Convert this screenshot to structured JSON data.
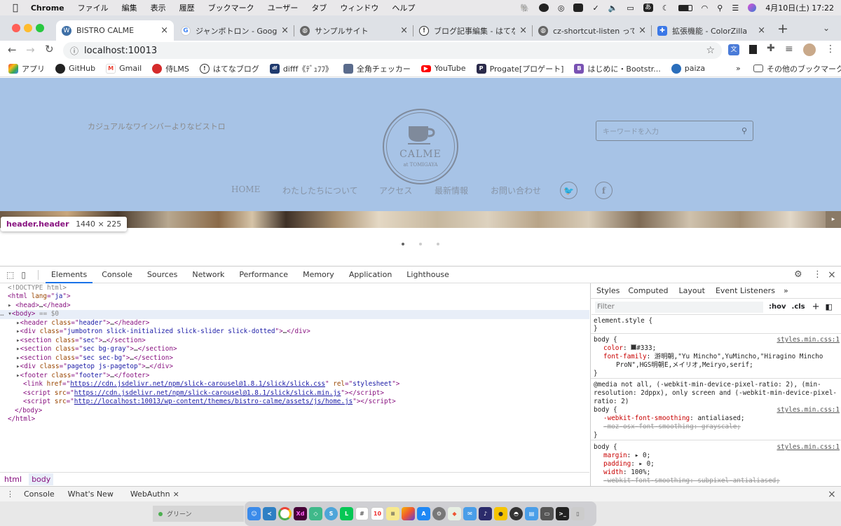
{
  "menubar": {
    "app": "Chrome",
    "items": [
      "ファイル",
      "編集",
      "表示",
      "履歴",
      "ブックマーク",
      "ユーザー",
      "タブ",
      "ウィンドウ",
      "ヘルプ"
    ],
    "datetime": "4月10日(土)  17:22",
    "ime": "あ"
  },
  "tabs": [
    {
      "title": "BISTRO CALME",
      "icon": "wordpress-icon",
      "active": true
    },
    {
      "title": "ジャンボトロン - Google 検索",
      "icon": "google-icon",
      "active": false
    },
    {
      "title": "サンプルサイト",
      "icon": "globe-icon",
      "active": false
    },
    {
      "title": "ブログ記事編集 - はてなブログ",
      "icon": "hatena-icon",
      "active": false
    },
    {
      "title": "cz-shortcut-listen って何",
      "icon": "globe-icon",
      "active": false
    },
    {
      "title": "拡張機能 - ColorZilla",
      "icon": "puzzle-icon",
      "active": false
    }
  ],
  "url": "localhost:10013",
  "bookmarks": [
    {
      "label": "アプリ",
      "color": "#e8453c"
    },
    {
      "label": "GitHub",
      "color": "#222222"
    },
    {
      "label": "Gmail",
      "color": "#ea4335"
    },
    {
      "label": "侍LMS",
      "color": "#d52b2b"
    },
    {
      "label": "はてなブログ",
      "color": "#333333"
    },
    {
      "label": "difff《ﾃﾞｭﾌﾌ》",
      "color": "#1f3a6e"
    },
    {
      "label": "全角チェッカー",
      "color": "#5a6b8c"
    },
    {
      "label": "YouTube",
      "color": "#ff0000"
    },
    {
      "label": "Progate[プロゲート]",
      "color": "#2a2a4a"
    },
    {
      "label": "はじめに・Bootstr...",
      "color": "#7952b3"
    },
    {
      "label": "paiza",
      "color": "#2a6ebb"
    }
  ],
  "bookmarks_other": "その他のブックマーク",
  "site": {
    "tagline": "カジュアルなワインバーよりなビストロ",
    "logo_name": "CALME",
    "logo_sub": "at TOMIGAYA",
    "search_placeholder": "キーワードを入力",
    "nav": [
      "HOME",
      "わたしたちについて",
      "アクセス",
      "最新情報",
      "お問い合わせ"
    ],
    "social": [
      "twitter-icon",
      "facebook-icon"
    ],
    "accent": "#a7c3e6"
  },
  "inspect_tooltip": {
    "selector": "header.header",
    "size": "1440 × 225"
  },
  "devtools": {
    "tabs": [
      "Elements",
      "Console",
      "Sources",
      "Network",
      "Performance",
      "Memory",
      "Application",
      "Lighthouse"
    ],
    "selected_tab": "Elements",
    "style_tabs": [
      "Styles",
      "Computed",
      "Layout",
      "Event Listeners"
    ],
    "filter_placeholder": "Filter",
    "hov": ":hov",
    "cls": ".cls",
    "dom": {
      "doctype": "<!DOCTYPE html>",
      "html_lang": "ja",
      "body_marker": "== $0",
      "link_href": "https://cdn.jsdelivr.net/npm/slick-carousel@1.8.1/slick/slick.css",
      "script1": "https://cdn.jsdelivr.net/npm/slick-carousel@1.8.1/slick/slick.min.js",
      "script2": "http://localhost:10013/wp-content/themes/bistro-calme/assets/js/home.js"
    },
    "styles": {
      "element_style": "element.style {",
      "source": "styles.min.css:1",
      "color_val": "#333;",
      "font_family": "游明朝,\"Yu Mincho\",YuMincho,\"Hiragino Mincho",
      "font_family2": "ProN\",HGS明朝E,メイリオ,Meiryo,serif;",
      "media1": "@media not all, (-webkit-min-device-pixel-ratio: 2), (min-",
      "media2": "resolution: 2dppx), only screen and (-webkit-min-device-pixel-",
      "media3": "ratio: 2)"
    },
    "breadcrumbs": [
      "html",
      "body"
    ]
  },
  "drawer": {
    "tabs": [
      "Console",
      "What's New",
      "WebAuthn"
    ],
    "active": "WebAuthn"
  },
  "bottom_hint": "グリーン"
}
